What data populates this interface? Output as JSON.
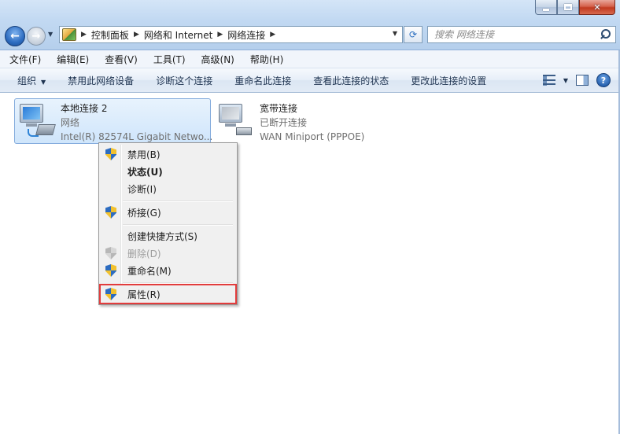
{
  "address": {
    "crumbs": [
      "控制面板",
      "网络和 Internet",
      "网络连接"
    ]
  },
  "search": {
    "placeholder": "搜索 网络连接"
  },
  "menubar": [
    "文件(F)",
    "编辑(E)",
    "查看(V)",
    "工具(T)",
    "高级(N)",
    "帮助(H)"
  ],
  "commands": {
    "organize": "组织",
    "items": [
      "禁用此网络设备",
      "诊断这个连接",
      "重命名此连接",
      "查看此连接的状态",
      "更改此连接的设置"
    ]
  },
  "connections": [
    {
      "name": "本地连接 2",
      "type": "网络",
      "device": "Intel(R) 82574L Gigabit Netwo...",
      "selected": true
    },
    {
      "name": "宽带连接",
      "type": "已断开连接",
      "device": "WAN Miniport (PPPOE)",
      "selected": false
    }
  ],
  "context_menu": {
    "items": [
      {
        "label": "禁用(B)",
        "icon": "shield-icon"
      },
      {
        "label": "状态(U)",
        "bold": true
      },
      {
        "label": "诊断(I)"
      },
      {
        "label": "桥接(G)",
        "icon": "shield-icon"
      },
      {
        "label": "创建快捷方式(S)"
      },
      {
        "label": "删除(D)",
        "icon": "shield-icon",
        "disabled": true
      },
      {
        "label": "重命名(M)",
        "icon": "shield-icon"
      },
      {
        "label": "属性(R)",
        "icon": "shield-icon",
        "highlighted": true
      }
    ],
    "highlight_color": "#e23c3c"
  }
}
